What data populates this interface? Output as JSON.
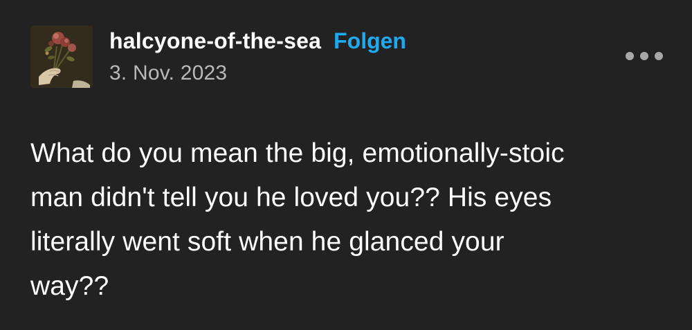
{
  "post": {
    "username": "halcyone-of-the-sea",
    "follow_label": "Folgen",
    "date": "3. Nov. 2023",
    "avatar_icon": "flower-bouquet-avatar-icon",
    "more_icon": "more-options-icon",
    "body_lines": [
      "What do you mean the big, emotionally-stoic",
      "man didn't tell you he loved you?? His eyes",
      "literally went soft when he glanced your",
      "way??"
    ]
  },
  "colors": {
    "background": "#222222",
    "text": "#ffffff",
    "follow": "#1eaaf1",
    "date": "#b9b9b9",
    "dots": "#a8a8a8"
  }
}
